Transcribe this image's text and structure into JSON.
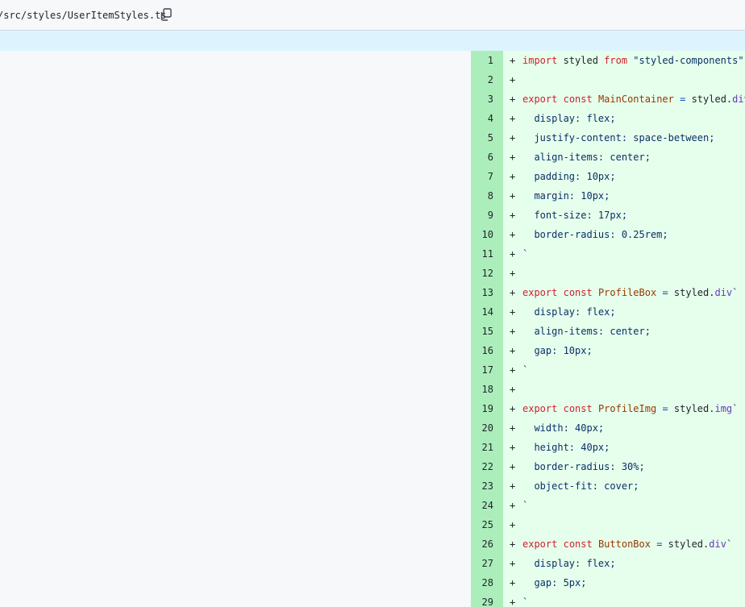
{
  "file": {
    "path": "/src/styles/UserItemStyles.ts",
    "copy_icon": "copy-icon"
  },
  "diff": {
    "sign": "+",
    "lines": [
      {
        "n": "1",
        "parts": [
          {
            "t": "import",
            "c": "k"
          },
          {
            "t": " styled ",
            "c": ""
          },
          {
            "t": "from",
            "c": "k"
          },
          {
            "t": " ",
            "c": ""
          },
          {
            "t": "\"styled-components\"",
            "c": "s"
          }
        ]
      },
      {
        "n": "2",
        "parts": []
      },
      {
        "n": "3",
        "parts": [
          {
            "t": "export",
            "c": "k"
          },
          {
            "t": " ",
            "c": ""
          },
          {
            "t": "const",
            "c": "k"
          },
          {
            "t": " ",
            "c": ""
          },
          {
            "t": "MainContainer",
            "c": "f"
          },
          {
            "t": " ",
            "c": ""
          },
          {
            "t": "=",
            "c": "p"
          },
          {
            "t": " styled.",
            "c": ""
          },
          {
            "t": "div",
            "c": "t"
          },
          {
            "t": "`",
            "c": "s"
          }
        ]
      },
      {
        "n": "4",
        "parts": [
          {
            "t": "  display: flex;",
            "c": "s"
          }
        ]
      },
      {
        "n": "5",
        "parts": [
          {
            "t": "  justify-content: space-between;",
            "c": "s"
          }
        ]
      },
      {
        "n": "6",
        "parts": [
          {
            "t": "  align-items: center;",
            "c": "s"
          }
        ]
      },
      {
        "n": "7",
        "parts": [
          {
            "t": "  padding: 10px;",
            "c": "s"
          }
        ]
      },
      {
        "n": "8",
        "parts": [
          {
            "t": "  margin: 10px;",
            "c": "s"
          }
        ]
      },
      {
        "n": "9",
        "parts": [
          {
            "t": "  font-size: 17px;",
            "c": "s"
          }
        ]
      },
      {
        "n": "10",
        "parts": [
          {
            "t": "  border-radius: 0.25rem;",
            "c": "s"
          }
        ]
      },
      {
        "n": "11",
        "parts": [
          {
            "t": "`",
            "c": "s"
          }
        ]
      },
      {
        "n": "12",
        "parts": []
      },
      {
        "n": "13",
        "parts": [
          {
            "t": "export",
            "c": "k"
          },
          {
            "t": " ",
            "c": ""
          },
          {
            "t": "const",
            "c": "k"
          },
          {
            "t": " ",
            "c": ""
          },
          {
            "t": "ProfileBox",
            "c": "f"
          },
          {
            "t": " ",
            "c": ""
          },
          {
            "t": "=",
            "c": "p"
          },
          {
            "t": " styled.",
            "c": ""
          },
          {
            "t": "div",
            "c": "t"
          },
          {
            "t": "`",
            "c": "s"
          }
        ]
      },
      {
        "n": "14",
        "parts": [
          {
            "t": "  display: flex;",
            "c": "s"
          }
        ]
      },
      {
        "n": "15",
        "parts": [
          {
            "t": "  align-items: center;",
            "c": "s"
          }
        ]
      },
      {
        "n": "16",
        "parts": [
          {
            "t": "  gap: 10px;",
            "c": "s"
          }
        ]
      },
      {
        "n": "17",
        "parts": [
          {
            "t": "`",
            "c": "s"
          }
        ]
      },
      {
        "n": "18",
        "parts": []
      },
      {
        "n": "19",
        "parts": [
          {
            "t": "export",
            "c": "k"
          },
          {
            "t": " ",
            "c": ""
          },
          {
            "t": "const",
            "c": "k"
          },
          {
            "t": " ",
            "c": ""
          },
          {
            "t": "ProfileImg",
            "c": "f"
          },
          {
            "t": " ",
            "c": ""
          },
          {
            "t": "=",
            "c": "p"
          },
          {
            "t": " styled.",
            "c": ""
          },
          {
            "t": "img",
            "c": "t"
          },
          {
            "t": "`",
            "c": "s"
          }
        ]
      },
      {
        "n": "20",
        "parts": [
          {
            "t": "  width: 40px;",
            "c": "s"
          }
        ]
      },
      {
        "n": "21",
        "parts": [
          {
            "t": "  height: 40px;",
            "c": "s"
          }
        ]
      },
      {
        "n": "22",
        "parts": [
          {
            "t": "  border-radius: 30%;",
            "c": "s"
          }
        ]
      },
      {
        "n": "23",
        "parts": [
          {
            "t": "  object-fit: cover;",
            "c": "s"
          }
        ]
      },
      {
        "n": "24",
        "parts": [
          {
            "t": "`",
            "c": "s"
          }
        ]
      },
      {
        "n": "25",
        "parts": []
      },
      {
        "n": "26",
        "parts": [
          {
            "t": "export",
            "c": "k"
          },
          {
            "t": " ",
            "c": ""
          },
          {
            "t": "const",
            "c": "k"
          },
          {
            "t": " ",
            "c": ""
          },
          {
            "t": "ButtonBox",
            "c": "f"
          },
          {
            "t": " ",
            "c": ""
          },
          {
            "t": "=",
            "c": "p"
          },
          {
            "t": " styled.",
            "c": ""
          },
          {
            "t": "div",
            "c": "t"
          },
          {
            "t": "`",
            "c": "s"
          }
        ]
      },
      {
        "n": "27",
        "parts": [
          {
            "t": "  display: flex;",
            "c": "s"
          }
        ]
      },
      {
        "n": "28",
        "parts": [
          {
            "t": "  gap: 5px;",
            "c": "s"
          }
        ]
      },
      {
        "n": "29",
        "parts": [
          {
            "t": "`",
            "c": "s"
          }
        ]
      }
    ]
  }
}
